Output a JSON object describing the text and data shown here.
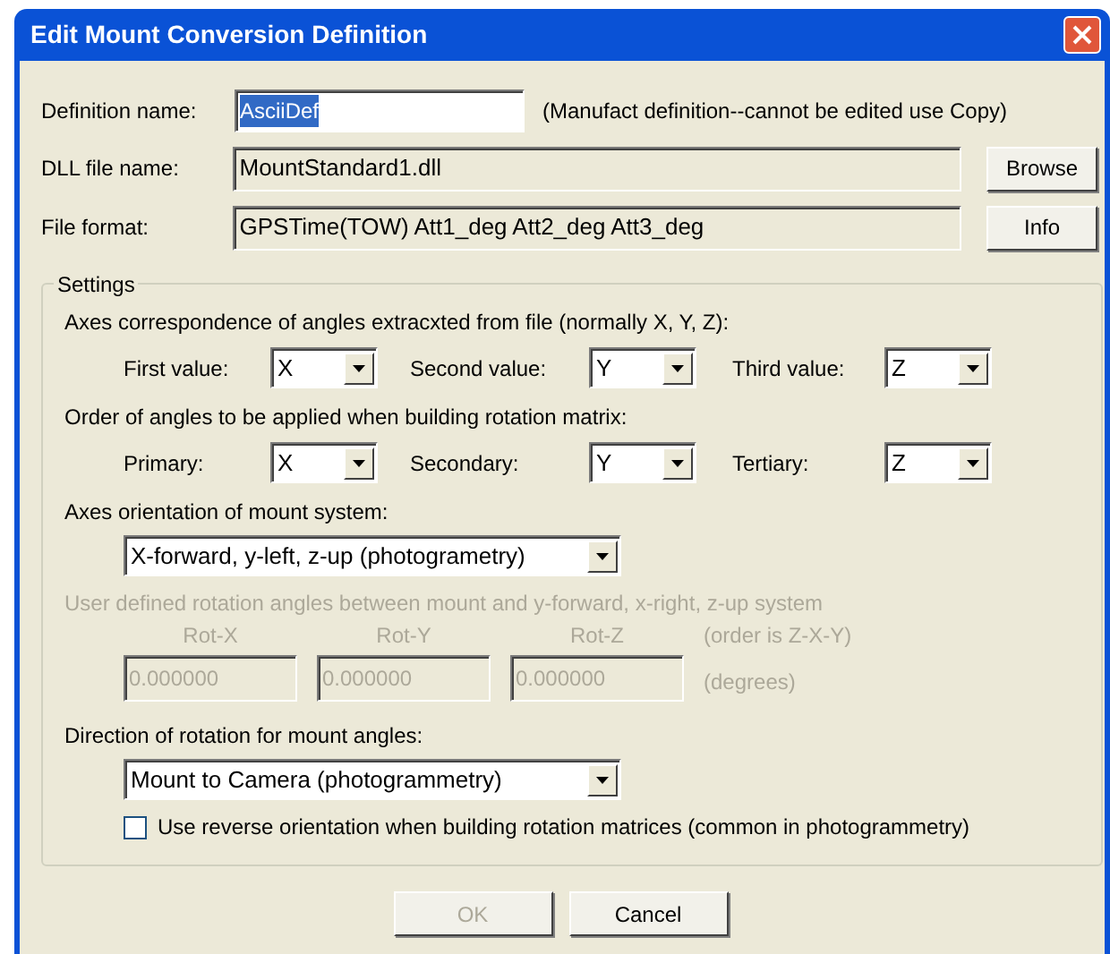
{
  "window": {
    "title": "Edit Mount Conversion Definition"
  },
  "definition_name": {
    "label": "Definition name:",
    "value": "AsciiDef",
    "text_selected": true,
    "note": "(Manufact definition--cannot be edited use Copy)"
  },
  "dll_file": {
    "label": "DLL file name:",
    "value": "MountStandard1.dll",
    "button": "Browse"
  },
  "file_format": {
    "label": "File format:",
    "value": "GPSTime(TOW) Att1_deg Att2_deg Att3_deg",
    "button": "Info"
  },
  "settings": {
    "legend": "Settings",
    "axes_correspondence": {
      "caption": "Axes correspondence of angles extracxted from file (normally X, Y, Z):",
      "combos": [
        {
          "label": "First value:",
          "value": "X"
        },
        {
          "label": "Second value:",
          "value": "Y"
        },
        {
          "label": "Third value:",
          "value": "Z"
        }
      ]
    },
    "rotation_order": {
      "caption": "Order of angles to be applied when building rotation matrix:",
      "combos": [
        {
          "label": "Primary:",
          "value": "X"
        },
        {
          "label": "Secondary:",
          "value": "Y"
        },
        {
          "label": "Tertiary:",
          "value": "Z"
        }
      ]
    },
    "mount_orientation": {
      "caption": "Axes orientation of mount system:",
      "value": "X-forward, y-left, z-up (photogrametry)"
    },
    "user_rotation": {
      "disabled": true,
      "caption": "User defined rotation angles between mount and y-forward, x-right, z-up system",
      "order_note": "(order is Z-X-Y)",
      "units": "(degrees)",
      "angles": [
        {
          "label": "Rot-X",
          "value": "0.000000"
        },
        {
          "label": "Rot-Y",
          "value": "0.000000"
        },
        {
          "label": "Rot-Z",
          "value": "0.000000"
        }
      ]
    },
    "rotation_direction": {
      "caption": "Direction of rotation for mount angles:",
      "value": "Mount to Camera (photogrammetry)"
    },
    "reverse_orientation": {
      "label": "Use reverse orientation when building rotation matrices (common in photogrammetry)",
      "checked": false
    }
  },
  "buttons": [
    {
      "label": "OK",
      "disabled": true
    },
    {
      "label": "Cancel",
      "disabled": false
    }
  ]
}
